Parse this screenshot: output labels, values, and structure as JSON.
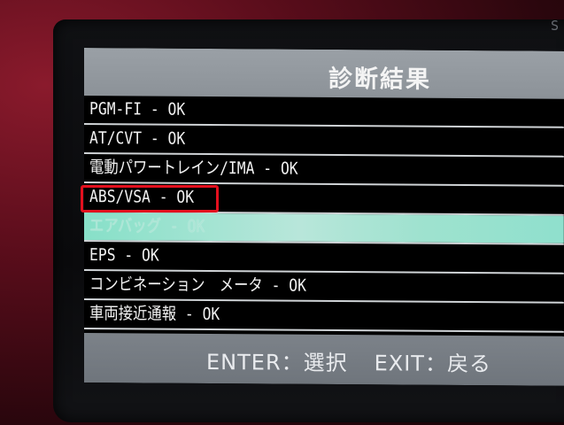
{
  "device": {
    "brand_mark": "S"
  },
  "screen": {
    "title": "診断結果",
    "rows": [
      {
        "label": "PGM-FI - OK"
      },
      {
        "label": "AT/CVT - OK"
      },
      {
        "label": "電動パワートレイン/IMA - OK"
      },
      {
        "label": "ABS/VSA - OK"
      },
      {
        "label": "エアバッグ - OK"
      },
      {
        "label": "EPS - OK"
      },
      {
        "label": "コンビネーション　メータ - OK"
      },
      {
        "label": "車両接近通報 - OK"
      }
    ],
    "selected_row": 4,
    "highlighted_row_color": "#87e0c8",
    "annotation_color": "#e3101e",
    "footer": {
      "enter_hint": "ENTER：選択",
      "exit_hint": "EXIT：戻る"
    }
  }
}
